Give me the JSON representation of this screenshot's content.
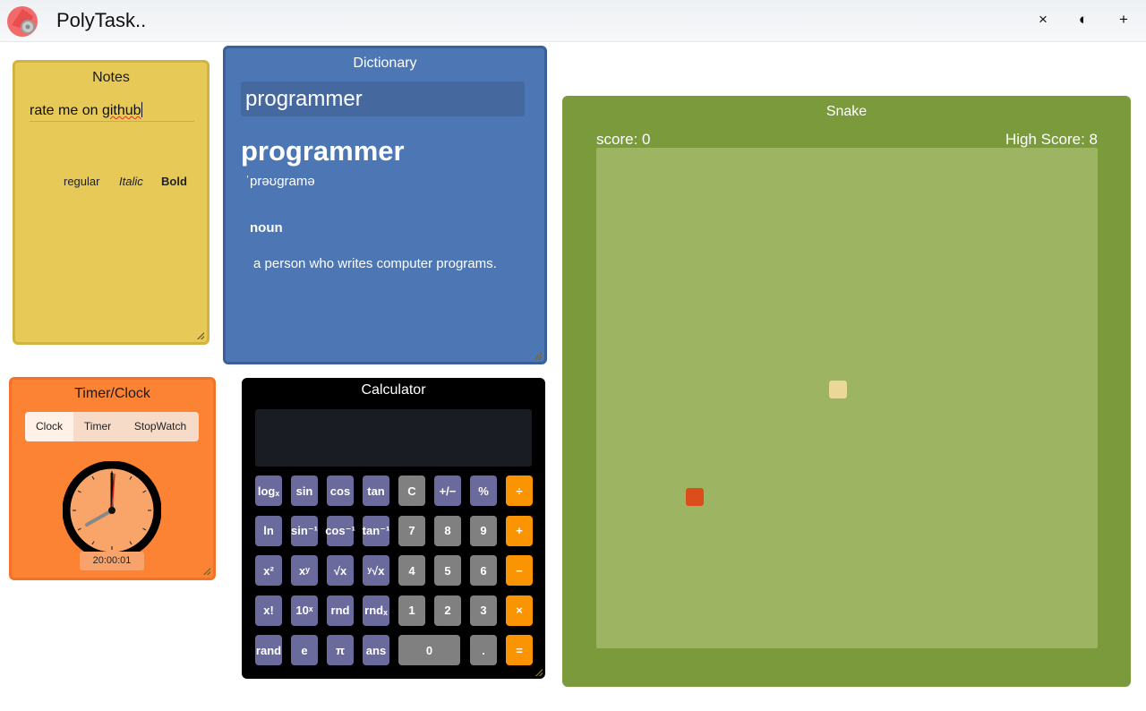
{
  "app": {
    "title": "PolyTask..",
    "logo_icon": "polytask-logo-icon"
  },
  "topbar": {
    "close_icon": "×",
    "theme_icon": "◐",
    "add_icon": "+"
  },
  "notes": {
    "title": "Notes",
    "text_before": "rate me on ",
    "text_misspelled": "github",
    "formats": [
      "regular",
      "Italic",
      "Bold"
    ]
  },
  "dictionary": {
    "title": "Dictionary",
    "query": "programmer",
    "word": "programmer",
    "phonetic": "ˈprəʊɡramə",
    "part_of_speech": "noun",
    "definition": "a person who writes computer programs."
  },
  "timer_clock": {
    "title": "Timer/Clock",
    "tabs": [
      "Clock",
      "Timer",
      "StopWatch"
    ],
    "active_tab": "Clock",
    "time": "20:00:01"
  },
  "calculator": {
    "title": "Calculator",
    "display": "",
    "rows": [
      [
        [
          "logₓ",
          "fn"
        ],
        [
          "sin",
          "fn"
        ],
        [
          "cos",
          "fn"
        ],
        [
          "tan",
          "fn"
        ],
        [
          "C",
          "num"
        ],
        [
          "+/−",
          "fn"
        ],
        [
          "%",
          "fn"
        ],
        [
          "÷",
          "op"
        ]
      ],
      [
        [
          "ln",
          "fn"
        ],
        [
          "sin⁻¹",
          "fn"
        ],
        [
          "cos⁻¹",
          "fn"
        ],
        [
          "tan⁻¹",
          "fn"
        ],
        [
          "7",
          "num"
        ],
        [
          "8",
          "num"
        ],
        [
          "9",
          "num"
        ],
        [
          "+",
          "op"
        ]
      ],
      [
        [
          "x²",
          "fn"
        ],
        [
          "xʸ",
          "fn"
        ],
        [
          "√x",
          "fn"
        ],
        [
          "ʸ√x",
          "fn"
        ],
        [
          "4",
          "num"
        ],
        [
          "5",
          "num"
        ],
        [
          "6",
          "num"
        ],
        [
          "−",
          "op"
        ]
      ],
      [
        [
          "x!",
          "fn"
        ],
        [
          "10ˣ",
          "fn"
        ],
        [
          "rnd",
          "fn"
        ],
        [
          "rndₓ",
          "fn"
        ],
        [
          "1",
          "num"
        ],
        [
          "2",
          "num"
        ],
        [
          "3",
          "num"
        ],
        [
          "×",
          "op"
        ]
      ],
      [
        [
          "rand",
          "fn"
        ],
        [
          "e",
          "fn"
        ],
        [
          "π",
          "fn"
        ],
        [
          "ans",
          "fn"
        ],
        [
          "0",
          "num"
        ],
        [
          ".",
          "num"
        ],
        [
          "=",
          "op"
        ]
      ]
    ]
  },
  "snake": {
    "title": "Snake",
    "score_label": "score: 0",
    "high_score_label": "High Score: 8"
  },
  "colors": {
    "notes_bg": "#e6c957",
    "dictionary_bg": "#4d76b4",
    "timer_bg": "#fb8333",
    "calculator_bg": "#000000",
    "snake_bg": "#7a9a3c",
    "snake_board": "#9db563",
    "snake_head": "#dc4d1c",
    "snake_food": "#ebd797"
  }
}
